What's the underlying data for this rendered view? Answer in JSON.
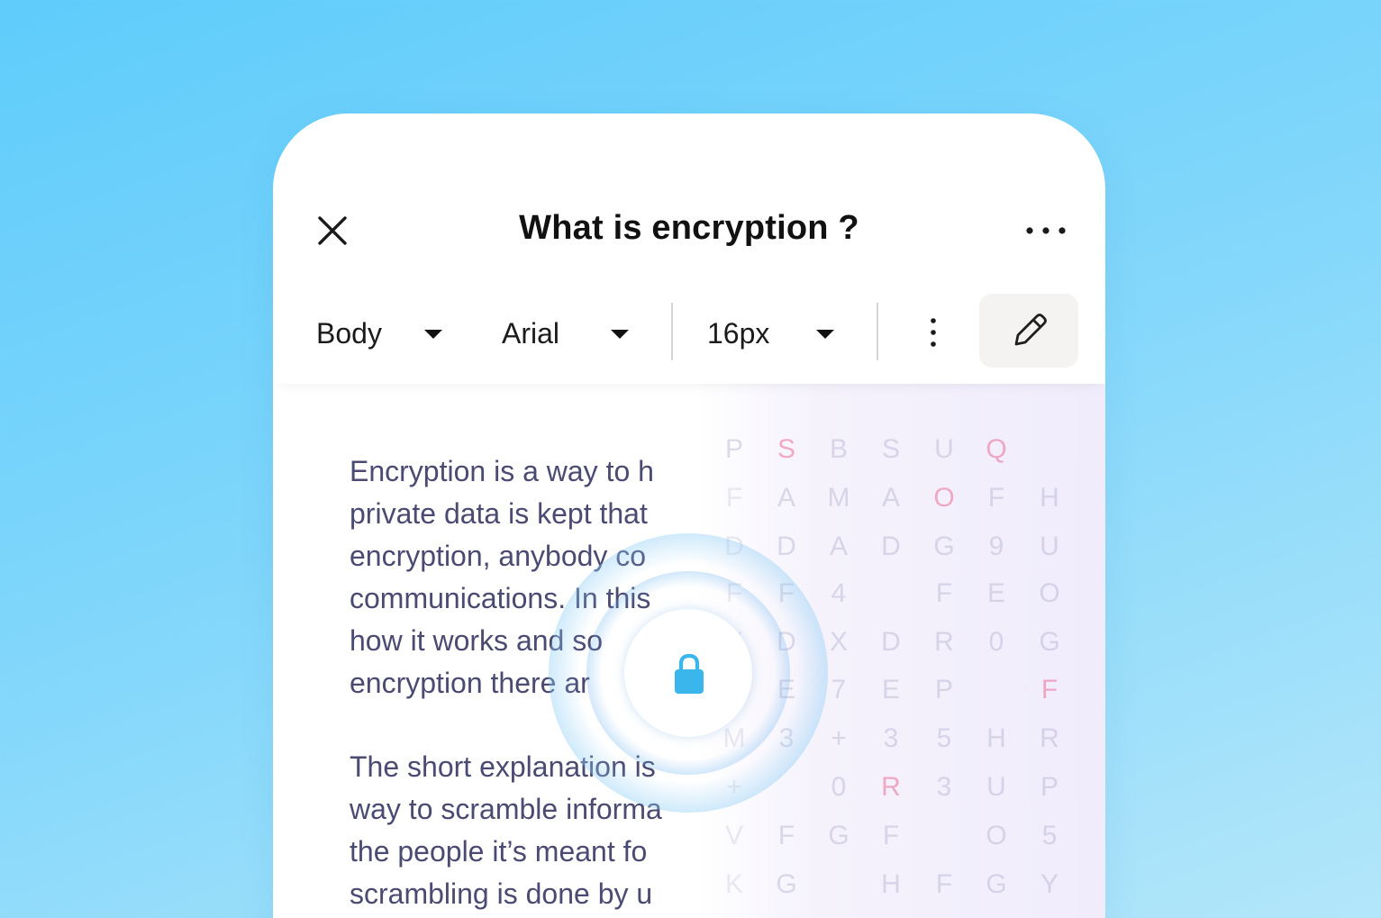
{
  "header": {
    "title": "What is encryption ?",
    "close_icon": "close-icon",
    "more_icon": "more-horizontal-icon"
  },
  "toolbar": {
    "style_select": {
      "value": "Body"
    },
    "font_select": {
      "value": "Arial"
    },
    "size_select": {
      "value": "16px"
    },
    "more_icon": "more-vertical-icon",
    "edit_icon": "pencil-icon"
  },
  "content": {
    "paragraph1": [
      "Encryption is a way to h",
      "private data is kept that",
      "encryption, anybody co",
      "communications. In this",
      "how it works and so",
      "encryption there ar"
    ],
    "paragraph2": [
      "The short explanation is",
      "way to scramble informa",
      "the people it’s meant fo",
      "scrambling is done by u"
    ]
  },
  "cipher": {
    "rows": [
      [
        "P",
        "S",
        "B",
        "S",
        "U",
        "Q",
        ""
      ],
      [
        "F",
        "A",
        "M",
        "A",
        "O",
        "F",
        "H"
      ],
      [
        "D",
        "D",
        "A",
        "D",
        "G",
        "9",
        "U"
      ],
      [
        "F",
        "F",
        "4",
        "",
        "F",
        "E",
        "O"
      ],
      [
        "X",
        "D",
        "X",
        "D",
        "R",
        "0",
        "G"
      ],
      [
        "H",
        "E",
        "7",
        "E",
        "P",
        "",
        "F"
      ],
      [
        "M",
        "3",
        "+",
        "3",
        "5",
        "H",
        "R"
      ],
      [
        "+",
        "",
        "0",
        "R",
        "3",
        "U",
        "P"
      ],
      [
        "V",
        "F",
        "G",
        "F",
        "",
        "O",
        "5"
      ],
      [
        "K",
        "G",
        "",
        "H",
        "F",
        "G",
        "Y"
      ]
    ],
    "highlighted": [
      "0-1",
      "0-5",
      "1-4",
      "5-6",
      "7-3"
    ]
  },
  "lock": {
    "icon": "lock-icon",
    "color": "#3bb6ec"
  },
  "colors": {
    "background_top": "#5fccfb",
    "background_bottom": "#b3e6fa",
    "text": "#4a4a73",
    "cipher_pink": "#e96e96"
  }
}
